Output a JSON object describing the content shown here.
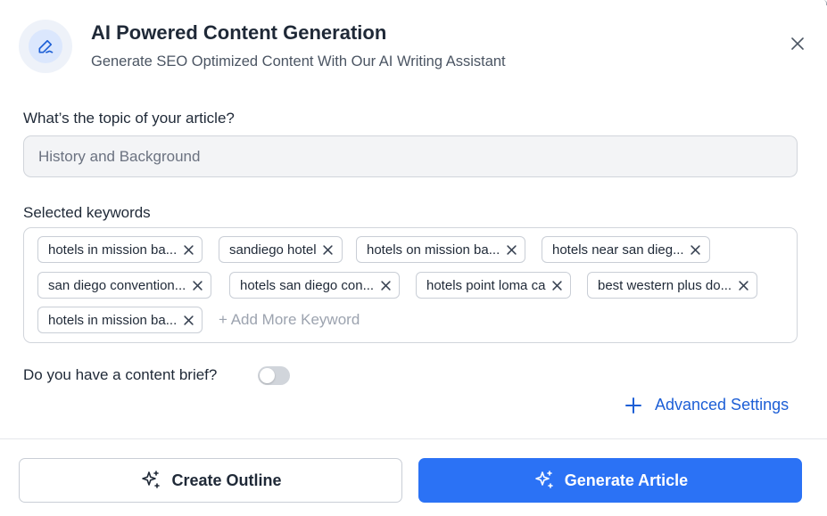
{
  "header": {
    "icon": "pen-line-icon",
    "title": "AI Powered Content Generation",
    "subtitle": "Generate SEO Optimized Content With Our AI Writing Assistant",
    "close_icon": "close-icon"
  },
  "topic": {
    "label": "What’s the topic of your article?",
    "placeholder": "History and Background",
    "value": ""
  },
  "keywords": {
    "label": "Selected keywords",
    "chips": [
      "hotels in mission ba...",
      "sandiego hotel",
      "hotels on mission ba...",
      "hotels near san dieg...",
      "san diego convention...",
      "hotels san diego con...",
      "hotels point loma ca",
      "best western plus do...",
      "hotels in mission ba..."
    ],
    "add_label": "+ Add More Keyword",
    "remove_icon": "close-icon"
  },
  "brief": {
    "label": "Do you have a content brief?",
    "enabled": false
  },
  "advanced": {
    "label": "Advanced Settings",
    "icon": "plus-icon"
  },
  "actions": {
    "outline_label": "Create Outline",
    "generate_label": "Generate Article",
    "icon": "sparkles-icon"
  },
  "colors": {
    "primary": "#2b72f5",
    "link": "#1d5fd6",
    "icon_bg": "#dbe7fd"
  }
}
